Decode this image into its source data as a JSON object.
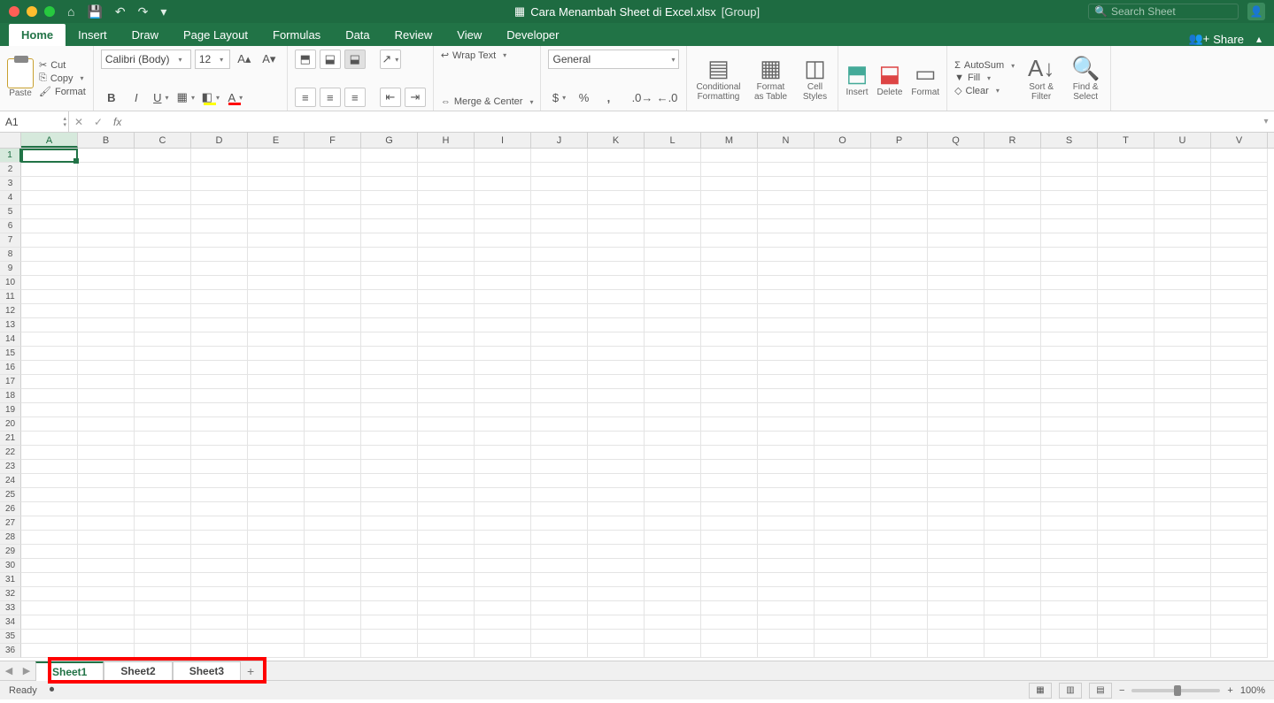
{
  "title": {
    "file": "Cara Menambah Sheet di Excel.xlsx",
    "suffix": "[Group]"
  },
  "search": {
    "placeholder": "Search Sheet"
  },
  "tabs": [
    "Home",
    "Insert",
    "Draw",
    "Page Layout",
    "Formulas",
    "Data",
    "Review",
    "View",
    "Developer"
  ],
  "share_label": "Share",
  "ribbon": {
    "paste": "Paste",
    "cut": "Cut",
    "copy": "Copy",
    "format_painter": "Format",
    "font_name": "Calibri (Body)",
    "font_size": "12",
    "wrap": "Wrap Text",
    "merge": "Merge & Center",
    "number_format": "General",
    "cond_fmt": "Conditional Formatting",
    "fmt_table": "Format as Table",
    "cell_styles": "Cell Styles",
    "insert": "Insert",
    "delete": "Delete",
    "format": "Format",
    "autosum": "AutoSum",
    "fill": "Fill",
    "clear": "Clear",
    "sort": "Sort & Filter",
    "find": "Find & Select"
  },
  "name_box": "A1",
  "columns": [
    "A",
    "B",
    "C",
    "D",
    "E",
    "F",
    "G",
    "H",
    "I",
    "J",
    "K",
    "L",
    "M",
    "N",
    "O",
    "P",
    "Q",
    "R",
    "S",
    "T",
    "U",
    "V"
  ],
  "row_count": 36,
  "sheets": [
    "Sheet1",
    "Sheet2",
    "Sheet3"
  ],
  "status": {
    "ready": "Ready",
    "zoom": "100%"
  }
}
